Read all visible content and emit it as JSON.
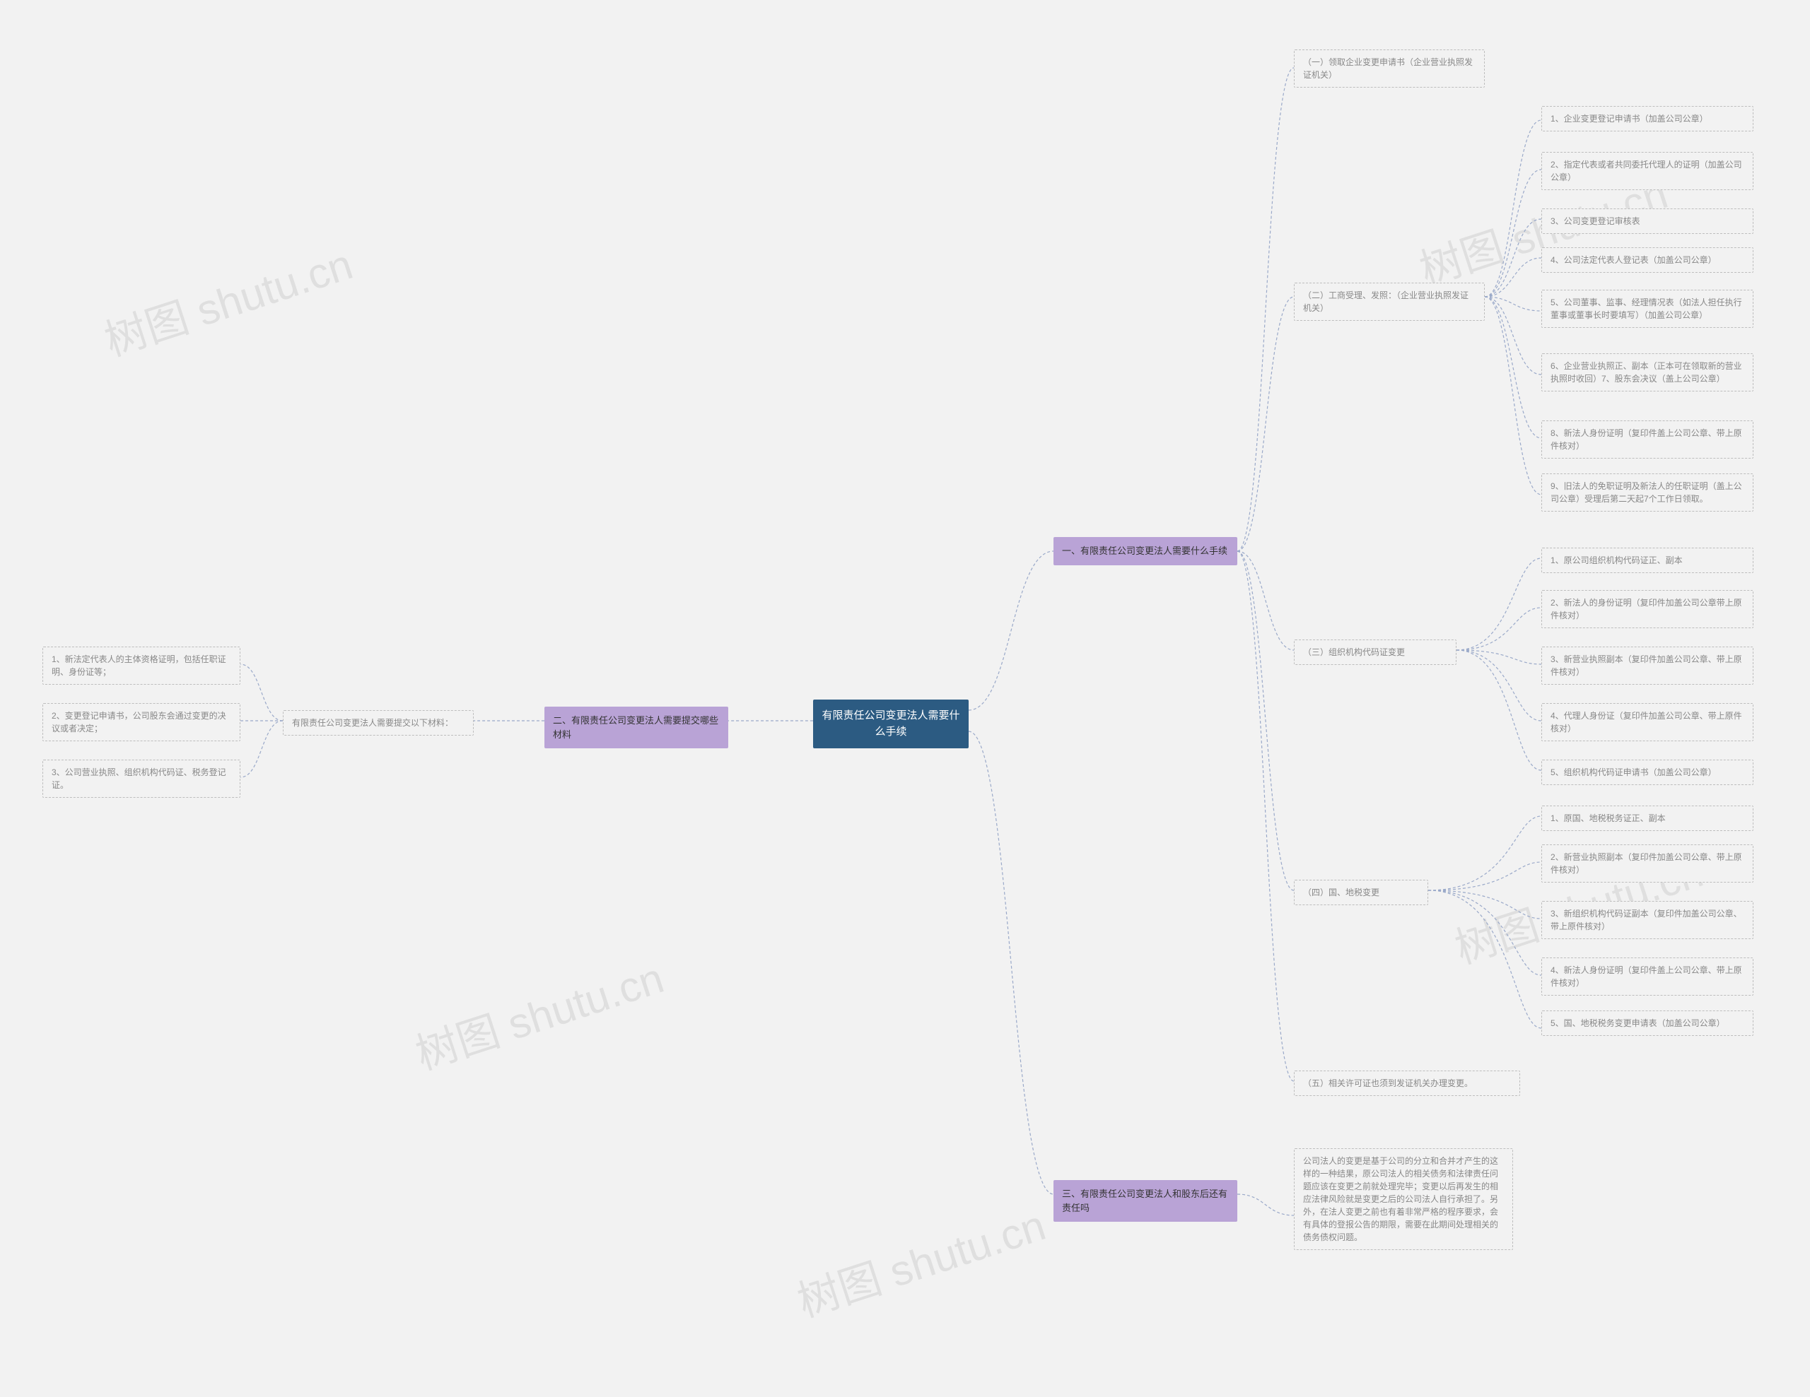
{
  "root_title": "有限责任公司变更法人需要什么手续",
  "sections": {
    "s1": {
      "title": "一、有限责任公司变更法人需要什么手续",
      "items": {
        "i1": {
          "label": "（一）领取企业变更申请书（企业营业执照发证机关）"
        },
        "i2": {
          "label": "（二）工商受理、发照：（企业营业执照发证机关）",
          "children": [
            "1、企业变更登记申请书（加盖公司公章）",
            "2、指定代表或者共同委托代理人的证明（加盖公司公章）",
            "3、公司变更登记审核表",
            "4、公司法定代表人登记表（加盖公司公章）",
            "5、公司董事、监事、经理情况表（如法人担任执行董事或董事长时要填写）（加盖公司公章）",
            "6、企业营业执照正、副本（正本可在领取新的营业执照时收回）7、股东会决议（盖上公司公章）",
            "8、新法人身份证明（复印件盖上公司公章、带上原件核对）",
            "9、旧法人的免职证明及新法人的任职证明（盖上公司公章）受理后第二天起7个工作日领取。"
          ]
        },
        "i3": {
          "label": "（三）组织机构代码证变更",
          "children": [
            "1、原公司组织机构代码证正、副本",
            "2、新法人的身份证明（复印件加盖公司公章带上原件核对）",
            "3、新营业执照副本（复印件加盖公司公章、带上原件核对）",
            "4、代理人身份证（复印件加盖公司公章、带上原件核对）",
            "5、组织机构代码证申请书（加盖公司公章）"
          ]
        },
        "i4": {
          "label": "（四）国、地税变更",
          "children": [
            "1、原国、地税税务证正、副本",
            "2、新营业执照副本（复印件加盖公司公章、带上原件核对）",
            "3、新组织机构代码证副本（复印件加盖公司公章、带上原件核对）",
            "4、新法人身份证明（复印件盖上公司公章、带上原件核对）",
            "5、国、地税税务变更申请表（加盖公司公章）"
          ]
        },
        "i5": {
          "label": "（五）相关许可证也须到发证机关办理变更。"
        }
      }
    },
    "s2": {
      "title": "二、有限责任公司变更法人需要提交哪些材料",
      "mid": "有限责任公司变更法人需要提交以下材料：",
      "children": [
        "1、新法定代表人的主体资格证明，包括任职证明、身份证等；",
        "2、变更登记申请书，公司股东会通过变更的决议或者决定；",
        "3、公司营业执照、组织机构代码证、税务登记证。"
      ]
    },
    "s3": {
      "title": "三、有限责任公司变更法人和股东后还有责任吗",
      "body": "公司法人的变更是基于公司的分立和合并才产生的这样的一种结果，原公司法人的相关债务和法律责任问题应该在变更之前就处理完毕；变更以后再发生的相应法律风险就是变更之后的公司法人自行承担了。另外，在法人变更之前也有着非常严格的程序要求，会有具体的登报公告的期限，需要在此期间处理相关的债务债权问题。"
    }
  },
  "chart_data": {
    "type": "table",
    "title": "有限责任公司变更法人需要什么手续",
    "structure": "mind-map",
    "root": "有限责任公司变更法人需要什么手续",
    "branches": [
      {
        "label": "一、有限责任公司变更法人需要什么手续",
        "children": [
          {
            "label": "（一）领取企业变更申请书（企业营业执照发证机关）"
          },
          {
            "label": "（二）工商受理、发照：（企业营业执照发证机关）",
            "children": [
              "1、企业变更登记申请书（加盖公司公章）",
              "2、指定代表或者共同委托代理人的证明（加盖公司公章）",
              "3、公司变更登记审核表",
              "4、公司法定代表人登记表（加盖公司公章）",
              "5、公司董事、监事、经理情况表（如法人担任执行董事或董事长时要填写）（加盖公司公章）",
              "6、企业营业执照正、副本（正本可在领取新的营业执照时收回）7、股东会决议（盖上公司公章）",
              "8、新法人身份证明（复印件盖上公司公章、带上原件核对）",
              "9、旧法人的免职证明及新法人的任职证明（盖上公司公章）受理后第二天起7个工作日领取。"
            ]
          },
          {
            "label": "（三）组织机构代码证变更",
            "children": [
              "1、原公司组织机构代码证正、副本",
              "2、新法人的身份证明（复印件加盖公司公章带上原件核对）",
              "3、新营业执照副本（复印件加盖公司公章、带上原件核对）",
              "4、代理人身份证（复印件加盖公司公章、带上原件核对）",
              "5、组织机构代码证申请书（加盖公司公章）"
            ]
          },
          {
            "label": "（四）国、地税变更",
            "children": [
              "1、原国、地税税务证正、副本",
              "2、新营业执照副本（复印件加盖公司公章、带上原件核对）",
              "3、新组织机构代码证副本（复印件加盖公司公章、带上原件核对）",
              "4、新法人身份证明（复印件盖上公司公章、带上原件核对）",
              "5、国、地税税务变更申请表（加盖公司公章）"
            ]
          },
          {
            "label": "（五）相关许可证也须到发证机关办理变更。"
          }
        ]
      },
      {
        "label": "二、有限责任公司变更法人需要提交哪些材料",
        "children": [
          {
            "label": "有限责任公司变更法人需要提交以下材料：",
            "children": [
              "1、新法定代表人的主体资格证明，包括任职证明、身份证等；",
              "2、变更登记申请书，公司股东会通过变更的决议或者决定；",
              "3、公司营业执照、组织机构代码证、税务登记证。"
            ]
          }
        ]
      },
      {
        "label": "三、有限责任公司变更法人和股东后还有责任吗",
        "children": [
          "公司法人的变更是基于公司的分立和合并才产生的这样的一种结果，原公司法人的相关债务和法律责任问题应该在变更之前就处理完毕；变更以后再发生的相应法律风险就是变更之后的公司法人自行承担了。另外，在法人变更之前也有着非常严格的程序要求，会有具体的登报公告的期限，需要在此期间处理相关的债务债权问题。"
        ]
      }
    ]
  },
  "watermark": "树图 shutu.cn"
}
